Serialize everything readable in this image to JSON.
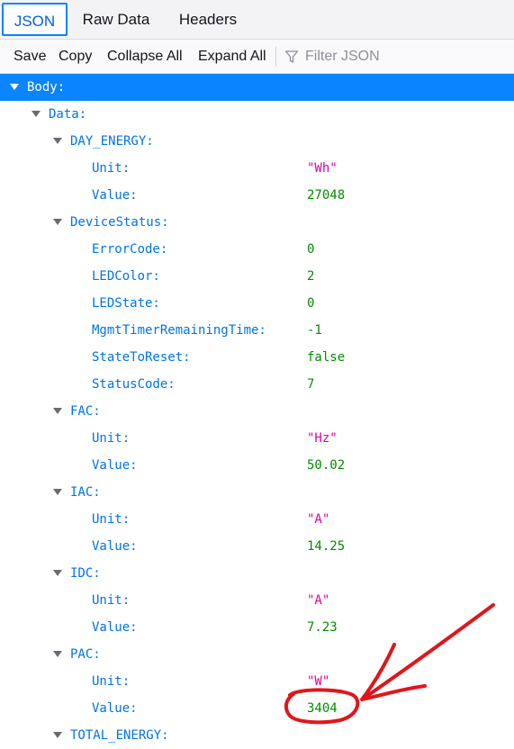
{
  "tabs": [
    {
      "label": "JSON",
      "active": true
    },
    {
      "label": "Raw Data",
      "active": false
    },
    {
      "label": "Headers",
      "active": false
    }
  ],
  "toolbar": {
    "save": "Save",
    "copy": "Copy",
    "collapse_all": "Collapse All",
    "expand_all": "Expand All",
    "filter_placeholder": "Filter JSON"
  },
  "tree": {
    "body_label": "Body:",
    "data_label": "Data:",
    "day_energy": {
      "label": "DAY_ENERGY:",
      "unit_key": "Unit:",
      "unit": "\"Wh\"",
      "value_key": "Value:",
      "value": "27048"
    },
    "device_status": {
      "label": "DeviceStatus:",
      "error_code_key": "ErrorCode:",
      "error_code": "0",
      "led_color_key": "LEDColor:",
      "led_color": "2",
      "led_state_key": "LEDState:",
      "led_state": "0",
      "mgmt_key": "MgmtTimerRemainingTime:",
      "mgmt": "-1",
      "state_reset_key": "StateToReset:",
      "state_reset": "false",
      "status_code_key": "StatusCode:",
      "status_code": "7"
    },
    "fac": {
      "label": "FAC:",
      "unit_key": "Unit:",
      "unit": "\"Hz\"",
      "value_key": "Value:",
      "value": "50.02"
    },
    "iac": {
      "label": "IAC:",
      "unit_key": "Unit:",
      "unit": "\"A\"",
      "value_key": "Value:",
      "value": "14.25"
    },
    "idc": {
      "label": "IDC:",
      "unit_key": "Unit:",
      "unit": "\"A\"",
      "value_key": "Value:",
      "value": "7.23"
    },
    "pac": {
      "label": "PAC:",
      "unit_key": "Unit:",
      "unit": "\"W\"",
      "value_key": "Value:",
      "value": "3404"
    },
    "total_energy": {
      "label": "TOTAL_ENERGY:"
    }
  },
  "colors": {
    "accent": "#0a84ff",
    "key": "#0074e8",
    "string": "#dd00a9",
    "number": "#058b00",
    "annotation": "#e0161b"
  }
}
